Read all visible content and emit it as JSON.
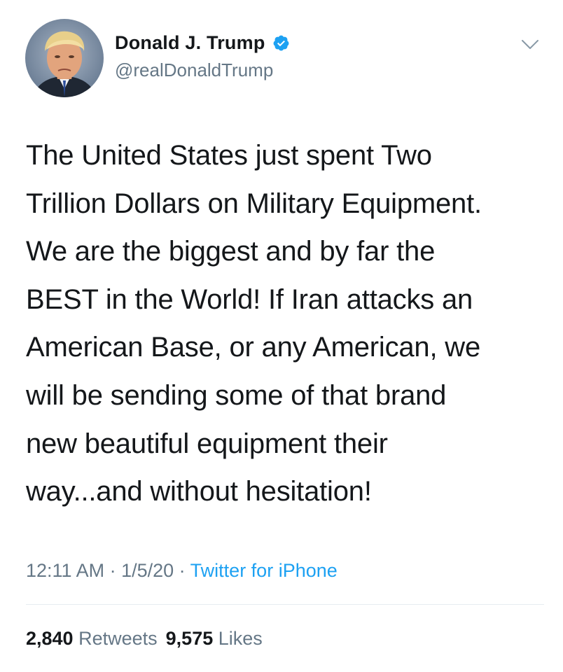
{
  "author": {
    "display_name": "Donald J. Trump",
    "handle": "@realDonaldTrump",
    "verified": true,
    "avatar_icon": "profile-photo",
    "verified_icon": "verified-badge-icon"
  },
  "header": {
    "menu_icon": "chevron-down-icon"
  },
  "tweet": {
    "lines": [
      "The United States just spent Two",
      "Trillion Dollars on Military Equipment.",
      "We are the biggest and by far the",
      "BEST in the World! If Iran attacks an",
      "American Base, or any American, we",
      "will be sending some of that brand",
      "new beautiful equipment their",
      "way...and without hesitation!"
    ]
  },
  "meta": {
    "time": "12:11 AM",
    "separator": " · ",
    "date": "1/5/20",
    "source": "Twitter for iPhone"
  },
  "stats": {
    "retweets_count": "2,840",
    "retweets_label": "Retweets",
    "likes_count": "9,575",
    "likes_label": "Likes"
  },
  "colors": {
    "text": "#14171a",
    "secondary": "#657786",
    "link": "#1da1f2",
    "verified": "#1da1f2",
    "divider": "#e6ecf0"
  }
}
